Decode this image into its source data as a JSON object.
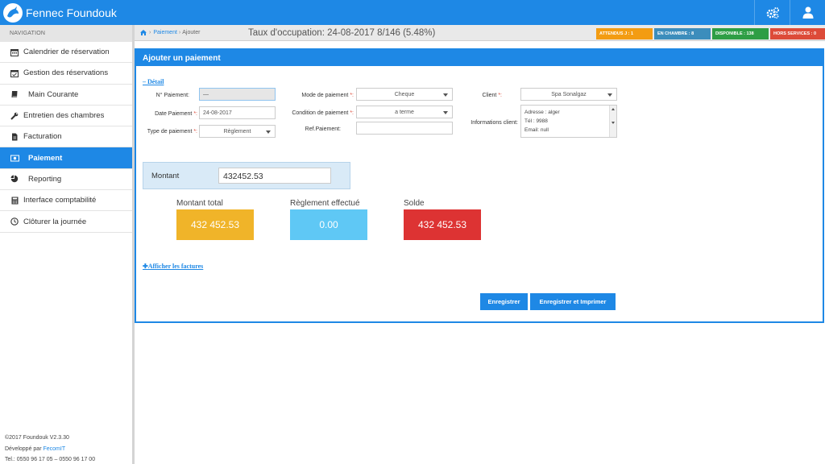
{
  "app": {
    "name": "Fennec Foundouk"
  },
  "colors": {
    "primary": "#1e88e5",
    "attendus": "#f39c12",
    "en_chambre": "#3c8dbc",
    "disponible": "#2e9e45",
    "hors_services": "#dd4b39",
    "total": "#f0b429",
    "reglement": "#5fc8f5",
    "solde": "#dd3333"
  },
  "sidebar": {
    "header": "NAVIGATION",
    "items": [
      {
        "label": "Calendrier de réservation",
        "icon": "calendar-icon"
      },
      {
        "label": "Gestion des réservations",
        "icon": "calendar-check-icon"
      },
      {
        "label": "Main Courante",
        "icon": "book-icon"
      },
      {
        "label": "Entretien des chambres",
        "icon": "wrench-icon"
      },
      {
        "label": "Facturation",
        "icon": "file-icon"
      },
      {
        "label": "Paiement",
        "icon": "money-icon"
      },
      {
        "label": "Reporting",
        "icon": "pie-chart-icon"
      },
      {
        "label": "Interface comptabilité",
        "icon": "calculator-icon"
      },
      {
        "label": "Clôturer la journée",
        "icon": "clock-icon"
      }
    ],
    "footer": {
      "version": "©2017 Foundouk V2.3.30",
      "dev_prefix": "Développé par ",
      "dev_name": "FecomIT",
      "phone": "Tel.: 0550 96 17 05 – 0550 96 17 00"
    }
  },
  "header": {
    "breadcrumb": {
      "parent": "Paiement",
      "current": "Ajouter"
    },
    "occupancy": "Taux d'occupation: 24-08-2017  8/146 (5.48%)",
    "badges": {
      "attendus": "ATTENDUS J : 1",
      "en_chambre": "EN CHAMBRE : 8",
      "disponible": "DISPONIBLE : 138",
      "hors_services": "HORS SERVICES : 0"
    }
  },
  "panel": {
    "title": "Ajouter un paiement",
    "detail_link": "– Détail",
    "form": {
      "num_label": "N° Paiement:",
      "num_value": "—",
      "date_label": "Date Paiement ",
      "date_value": "24-08-2017",
      "type_label": "Type de paiement ",
      "type_value": "Règlement",
      "mode_label": "Mode de paiement ",
      "mode_value": "Cheque",
      "condition_label": "Condition de paiement ",
      "condition_value": "a terme",
      "ref_label": "Ref.Paiement:",
      "ref_value": "",
      "client_label": "Client ",
      "client_value": "Spa Sonalgaz",
      "info_label": "Informations client:",
      "info_lines": [
        "Adresse : alger",
        "Tél : 9988",
        "Email: null"
      ],
      "req_mark": "*:"
    },
    "montant": {
      "label": "Montant",
      "value": "432452.53"
    },
    "stats": {
      "total_label": "Montant total",
      "total_value": "432 452.53",
      "reglement_label": "Règlement effectué",
      "reglement_value": "0.00",
      "solde_label": "Solde",
      "solde_value": "432 452.53"
    },
    "invoices_link": "✚Afficher les factures",
    "buttons": {
      "save": "Enregistrer",
      "save_print": "Enregistrer et Imprimer"
    }
  }
}
